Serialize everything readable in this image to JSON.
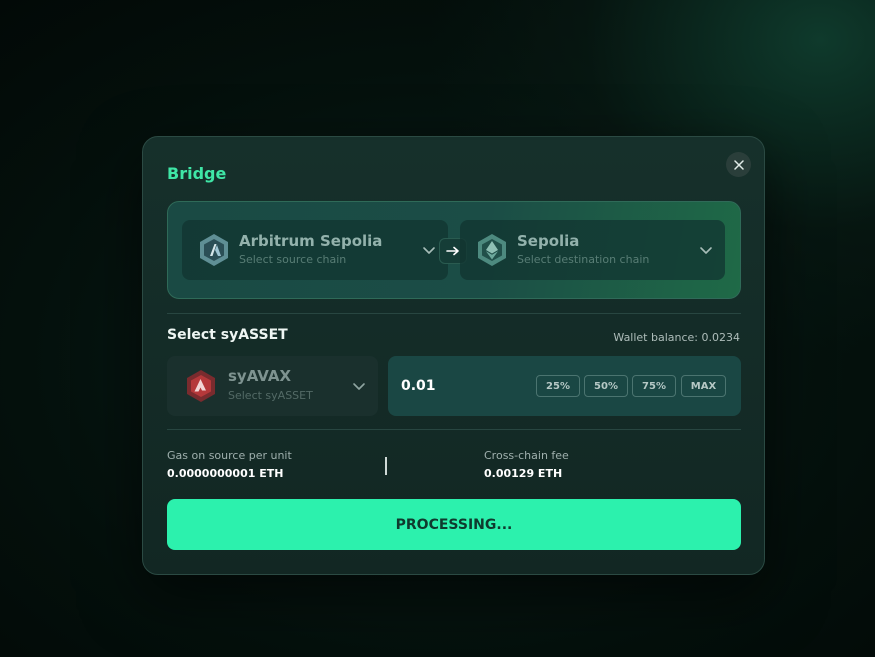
{
  "modal": {
    "title": "Bridge",
    "close_icon": "close-icon"
  },
  "source_chain": {
    "name": "Arbitrum Sepolia",
    "subtitle": "Select source chain",
    "icon": "arbitrum-icon"
  },
  "swap_icon": "arrow-right-icon",
  "destination_chain": {
    "name": "Sepolia",
    "subtitle": "Select destination chain",
    "icon": "ethereum-icon"
  },
  "asset_section": {
    "label": "Select syASSET",
    "wallet_balance": "Wallet balance: 0.0234"
  },
  "asset": {
    "name": "syAVAX",
    "subtitle": "Select syASSET",
    "icon": "avalanche-icon"
  },
  "amount": {
    "value": "0.01",
    "presets": [
      "25%",
      "50%",
      "75%",
      "MAX"
    ]
  },
  "fees": {
    "gas_label": "Gas on source per unit",
    "gas_value": "0.0000000001 ETH",
    "cross_chain_label": "Cross-chain fee",
    "cross_chain_value": "0.00129 ETH"
  },
  "submit_label": "PROCESSING...",
  "colors": {
    "accent": "#2cf1ad",
    "title": "#3fe6a6",
    "avax_red": "#b5383a"
  }
}
